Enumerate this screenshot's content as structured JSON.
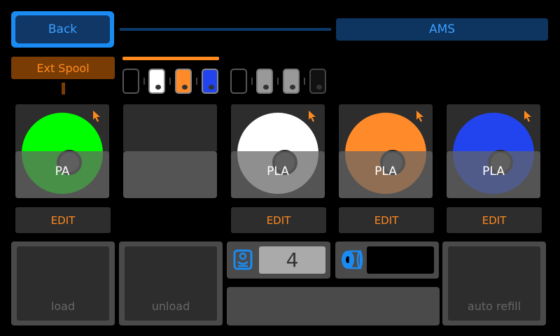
{
  "header": {
    "back_label": "Back",
    "ams_label": "AMS"
  },
  "external": {
    "label": "Ext Spool"
  },
  "mini_slots": [
    {
      "color": "#000000"
    },
    {
      "color": "#ffffff"
    },
    {
      "color": "#ff8a2a"
    },
    {
      "color": "#2244ee"
    },
    {
      "color": "#000000"
    },
    {
      "color": "#999999"
    },
    {
      "color": "#999999"
    },
    {
      "color": "#111111"
    }
  ],
  "trays": [
    {
      "material": "PA",
      "color": "#00ff00",
      "edit_label": "EDIT",
      "cursor_icon": "cursor-arrow-icon"
    },
    {
      "material": "",
      "color": "",
      "empty": true
    },
    {
      "material": "PLA",
      "color": "#ffffff",
      "edit_label": "EDIT",
      "cursor_icon": "cursor-arrow-icon"
    },
    {
      "material": "PLA",
      "color": "#ff8a2a",
      "edit_label": "EDIT",
      "cursor_icon": "cursor-arrow-icon"
    },
    {
      "material": "PLA",
      "color": "#2244ee",
      "edit_label": "EDIT",
      "cursor_icon": "cursor-arrow-icon"
    }
  ],
  "actions": {
    "load_label": "load",
    "unload_label": "unload",
    "auto_refill_label": "auto refill"
  },
  "nozzle": {
    "icon": "nozzle-icon",
    "value": "4"
  },
  "spool_status": {
    "icon": "spool-icon",
    "value": ""
  },
  "colors": {
    "accent_blue": "#1a8bf2",
    "accent_orange": "#ff8a1f"
  }
}
